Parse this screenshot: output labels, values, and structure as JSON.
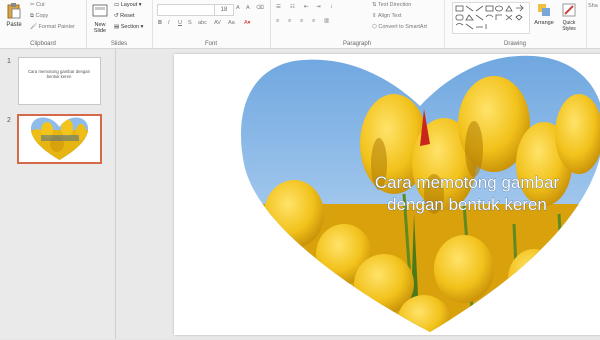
{
  "ribbon": {
    "clipboard": {
      "paste": "Paste",
      "cut": "Cut",
      "copy": "Copy",
      "format_painter": "Format Painter",
      "label": "Clipboard"
    },
    "slides": {
      "new_slide": "New Slide",
      "layout": "Layout",
      "reset": "Reset",
      "section": "Section",
      "label": "Slides"
    },
    "font": {
      "size_value": "18",
      "label": "Font"
    },
    "paragraph": {
      "text_direction": "Text Direction",
      "align_text": "Align Text",
      "convert_smartart": "Convert to SmartArt",
      "label": "Paragraph"
    },
    "drawing": {
      "arrange": "Arrange",
      "quick_styles": "Quick Styles",
      "label": "Drawing",
      "right_cut": "Sha"
    }
  },
  "thumbnails": [
    {
      "num": "1",
      "text": "Cara memotong gambar dengan bentuk keren"
    },
    {
      "num": "2",
      "text": ""
    }
  ],
  "slide": {
    "title_line1": "Cara memotong gambar",
    "title_line2": "dengan bentuk keren"
  },
  "colors": {
    "sky_top": "#6fa7e0",
    "sky_bottom": "#c9e0f6",
    "tulip": "#f2c21b",
    "tulip_shadow": "#c58d07",
    "stem": "#5f8a1f",
    "thumb_selected_border": "#d46a4a"
  }
}
